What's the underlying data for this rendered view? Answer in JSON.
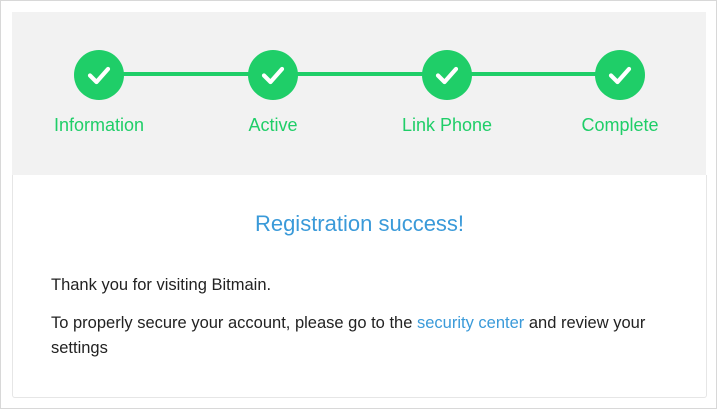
{
  "colors": {
    "accent_green": "#1fce68",
    "link_blue": "#3a9ad9",
    "panel_gray": "#f2f2f2"
  },
  "steps": [
    {
      "label": "Information",
      "icon": "check-icon",
      "status": "complete"
    },
    {
      "label": "Active",
      "icon": "check-icon",
      "status": "complete"
    },
    {
      "label": "Link Phone",
      "icon": "check-icon",
      "status": "complete"
    },
    {
      "label": "Complete",
      "icon": "check-icon",
      "status": "complete"
    }
  ],
  "content": {
    "title": "Registration success!",
    "thank_you": "Thank you for visiting Bitmain.",
    "secure_prefix": "To properly secure your account, please go to the ",
    "security_link": "security center",
    "secure_suffix": " and review your settings"
  }
}
